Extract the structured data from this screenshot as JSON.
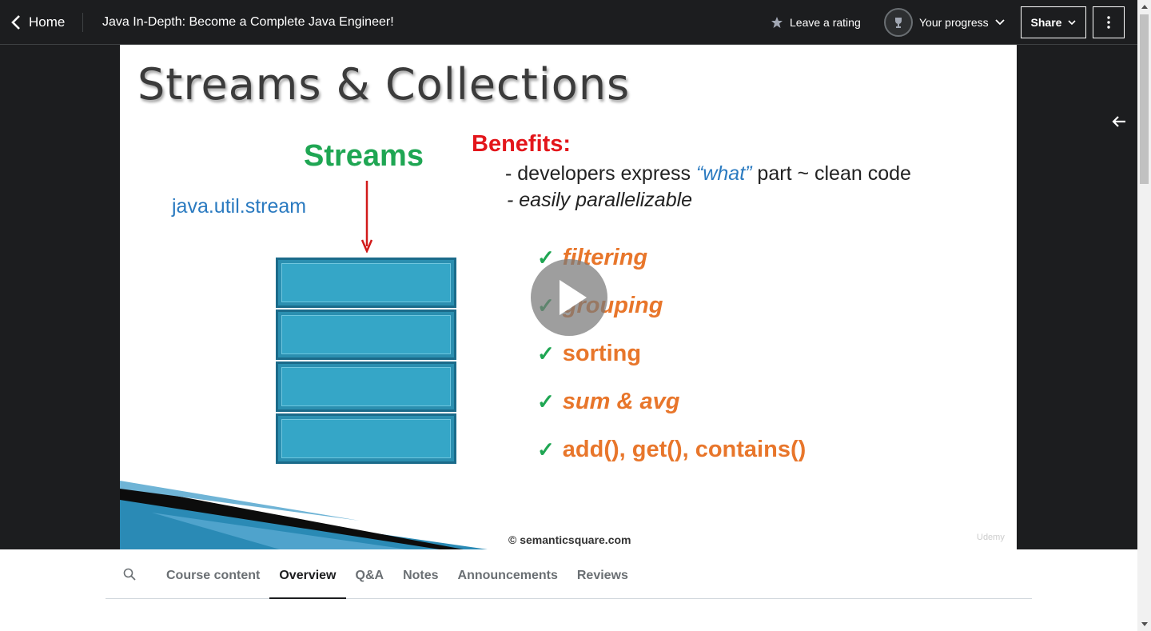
{
  "header": {
    "home_label": "Home",
    "course_title": "Java In-Depth: Become a Complete Java Engineer!",
    "rating_label": "Leave a rating",
    "progress_label": "Your progress",
    "share_label": "Share"
  },
  "slide": {
    "title": "Streams & Collections",
    "streams_label": "Streams",
    "package": "java.util.stream",
    "benefits_title": "Benefits:",
    "benefit_line1_prefix": "- developers  express ",
    "benefit_line1_what": "“what”",
    "benefit_line1_suffix": " part ~ clean code",
    "benefit_line2": "- easily parallelizable",
    "checks": [
      {
        "text": "filtering",
        "italic": true
      },
      {
        "text": "grouping",
        "italic": true
      },
      {
        "text": "sorting",
        "italic": false
      },
      {
        "text": "sum & avg",
        "italic": true
      },
      {
        "text": "add(), get(), contains()",
        "italic": false
      }
    ],
    "watermark": "© semanticsquare.com",
    "udemy_mark": "Udemy"
  },
  "tabs": [
    "Course content",
    "Overview",
    "Q&A",
    "Notes",
    "Announcements",
    "Reviews"
  ],
  "active_tab": "Overview",
  "colors": {
    "topbar_bg": "#1c1d1f",
    "streams_green": "#1fa653",
    "benefits_red": "#e3161b",
    "check_orange": "#e8762b",
    "package_blue": "#2a7ac0"
  }
}
